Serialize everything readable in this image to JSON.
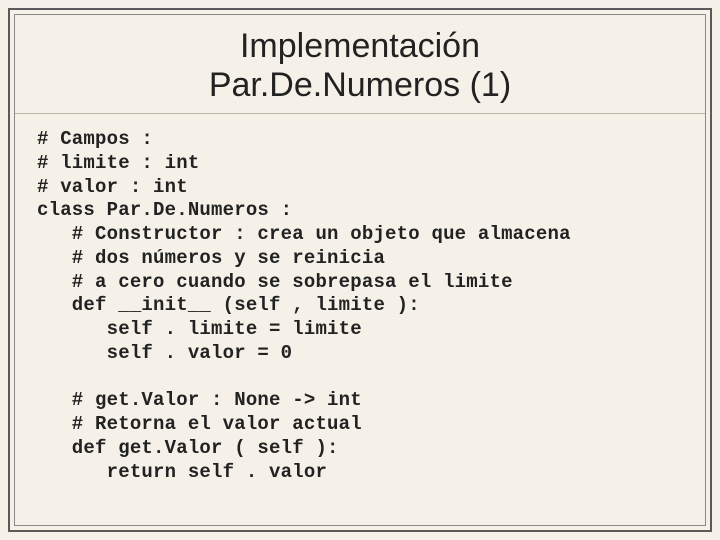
{
  "slide": {
    "title_line1": "Implementación",
    "title_line2": "Par.De.Numeros (1)",
    "code": "# Campos :\n# limite : int\n# valor : int\nclass Par.De.Numeros :\n   # Constructor : crea un objeto que almacena\n   # dos números y se reinicia\n   # a cero cuando se sobrepasa el limite\n   def __init__ (self , limite ):\n      self . limite = limite\n      self . valor = 0\n\n   # get.Valor : None -> int\n   # Retorna el valor actual\n   def get.Valor ( self ):\n      return self . valor"
  }
}
